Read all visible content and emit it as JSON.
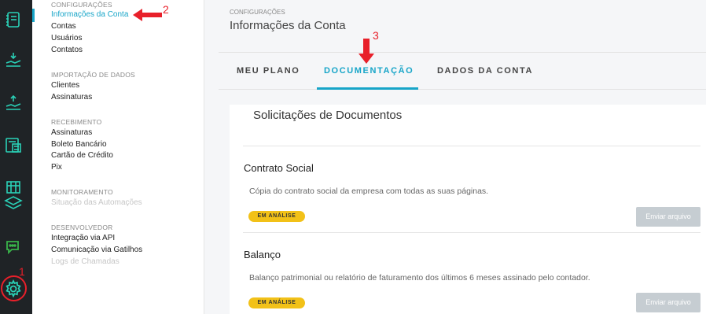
{
  "rail": {
    "icons": [
      "ledger-icon",
      "receive-money-icon",
      "hand-money-icon",
      "calculator-invoice-icon",
      "store-stack-icon",
      "chat-icon",
      "settings-gear-icon"
    ],
    "annotation": "1"
  },
  "menu": {
    "sections": [
      {
        "title": "CONFIGURAÇÕES",
        "items": [
          "Informações da Conta",
          "Contas",
          "Usuários",
          "Contatos"
        ]
      },
      {
        "title": "IMPORTAÇÃO DE DADOS",
        "items": [
          "Clientes",
          "Assinaturas"
        ]
      },
      {
        "title": "RECEBIMENTO",
        "items": [
          "Assinaturas",
          "Boleto Bancário",
          "Cartão de Crédito",
          "Pix"
        ]
      },
      {
        "title": "MONITORAMENTO",
        "items": [
          "Situação das Automações"
        ]
      },
      {
        "title": "DESENVOLVEDOR",
        "items": [
          "Integração via API",
          "Comunicação via Gatilhos",
          "Logs de Chamadas"
        ]
      }
    ],
    "annotation": "2"
  },
  "header": {
    "breadcrumb": "CONFIGURAÇÕES",
    "title": "Informações da Conta"
  },
  "tabs": {
    "items": [
      "MEU PLANO",
      "DOCUMENTAÇÃO",
      "DADOS DA CONTA"
    ],
    "active": "DOCUMENTAÇÃO",
    "annotation": "3"
  },
  "documents": {
    "title": "Solicitações de Documentos",
    "items": [
      {
        "name": "Contrato Social",
        "description": "Cópia do contrato social da empresa com todas as suas páginas.",
        "status": "EM ANÁLISE",
        "action": "Enviar arquivo"
      },
      {
        "name": "Balanço",
        "description": "Balanço patrimonial ou relatório de faturamento dos últimos 6 meses assinado pelo contador.",
        "status": "EM ANÁLISE",
        "action": "Enviar arquivo"
      }
    ]
  },
  "colors": {
    "accent": "#17a5c8",
    "annotation_red": "#e8202a",
    "badge_yellow": "#f2c118",
    "rail_bg": "#1f2326",
    "icon_teal": "#2ad1b7",
    "chat_green": "#39b54a"
  }
}
